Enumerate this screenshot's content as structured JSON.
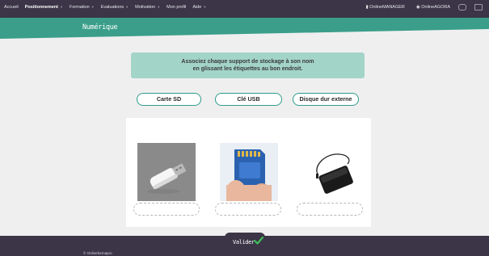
{
  "topnav": {
    "items": [
      {
        "label": "Accueil",
        "active": false,
        "dropdown": false
      },
      {
        "label": "Positionnement",
        "active": true,
        "dropdown": true
      },
      {
        "label": "Formation",
        "active": false,
        "dropdown": true
      },
      {
        "label": "Evaluations",
        "active": false,
        "dropdown": true
      },
      {
        "label": "Motivation",
        "active": false,
        "dropdown": true
      },
      {
        "label": "Mon profil",
        "active": false,
        "dropdown": false
      },
      {
        "label": "Aide",
        "active": false,
        "dropdown": true
      }
    ],
    "right": {
      "manager_label": "OnlineMANAGER",
      "agora_label": "OnlineAGORA"
    }
  },
  "banner": {
    "title": "Numérique",
    "color": "#3a9e8a"
  },
  "instruction": {
    "line1": "Associez chaque support de stockage à son nom",
    "line2": "en glissant les étiquettes au bon endroit."
  },
  "labels": [
    "Carte SD",
    "Clé USB",
    "Disque dur externe"
  ],
  "images": [
    {
      "icon": "usb-key-photo"
    },
    {
      "icon": "sd-card-photo"
    },
    {
      "icon": "external-hard-drive-photo"
    }
  ],
  "footer": {
    "valider_label": "Valider",
    "copyright": "© Onlineformapro"
  },
  "colors": {
    "topbar": "#3b3547",
    "accent": "#3a9e8a",
    "instruction_bg": "#a3d4c8",
    "check": "#3fbf5a"
  }
}
